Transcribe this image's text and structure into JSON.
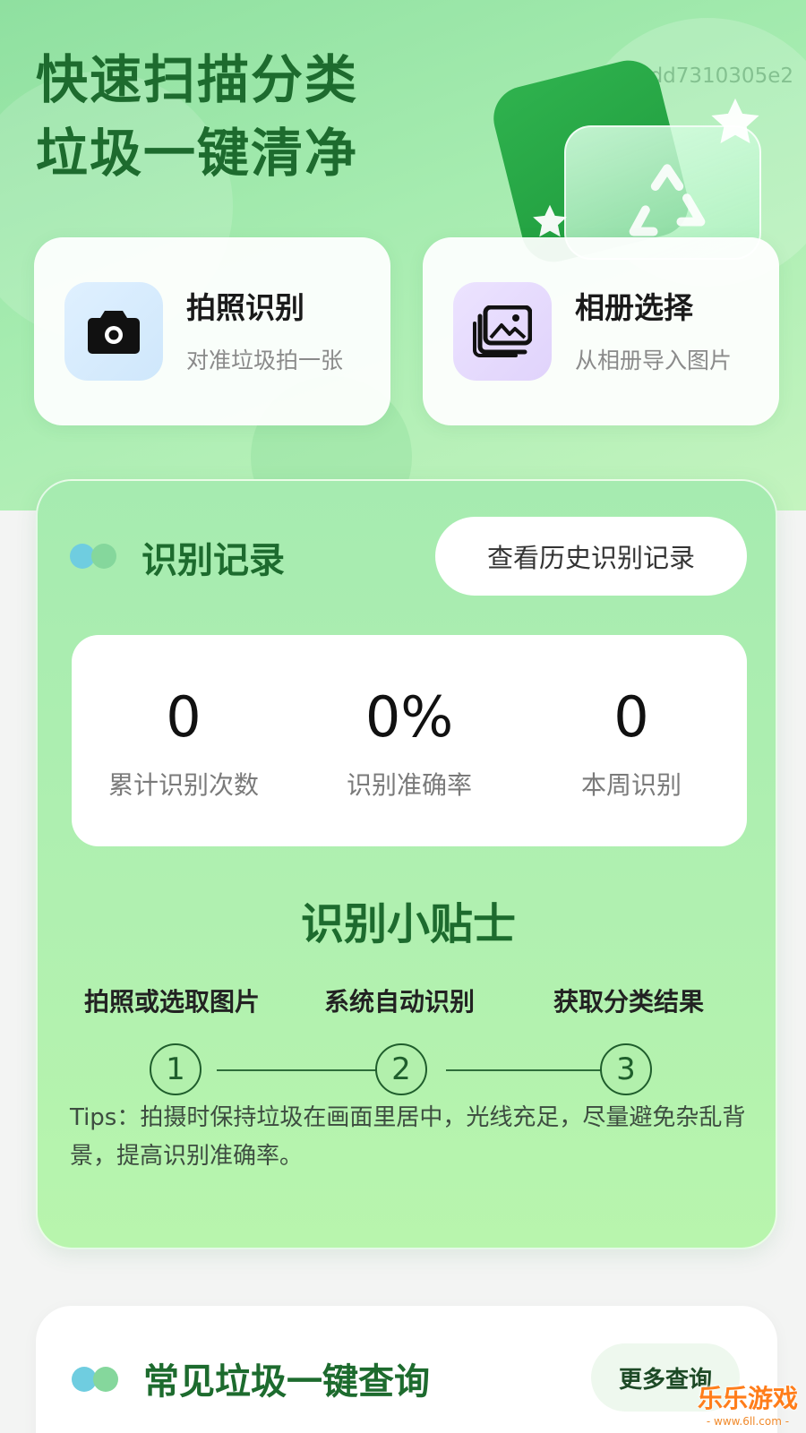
{
  "hero": {
    "title_line1": "快速扫描分类",
    "title_line2": "垃圾一键清净",
    "hash": "ef136dd7310305e2",
    "illustration_icon": "recycle-icon"
  },
  "actions": [
    {
      "title": "拍照识别",
      "subtitle": "对准垃圾拍一张",
      "icon": "camera-icon"
    },
    {
      "title": "相册选择",
      "subtitle": "从相册导入图片",
      "icon": "photo-album-icon"
    }
  ],
  "records": {
    "title": "识别记录",
    "history_button": "查看历史识别记录",
    "stats": [
      {
        "value": "0",
        "label": "累计识别次数"
      },
      {
        "value": "0%",
        "label": "识别准确率"
      },
      {
        "value": "0",
        "label": "本周识别"
      }
    ]
  },
  "tips": {
    "title": "识别小贴士",
    "steps": [
      {
        "label": "拍照或选取图片",
        "number": "1"
      },
      {
        "label": "系统自动识别",
        "number": "2"
      },
      {
        "label": "获取分类结果",
        "number": "3"
      }
    ],
    "text": "Tips：拍摄时保持垃圾在画面里居中，光线充足，尽量避免杂乱背景，提高识别准确率。"
  },
  "common_query": {
    "title": "常见垃圾一键查询",
    "more_button": "更多查询"
  },
  "watermark": {
    "title": "乐乐游戏",
    "url": "- www.6ll.com -"
  },
  "colors": {
    "brand_green": "#1d6b2e",
    "hero_gradient_start": "#8fe0a0",
    "panel_green": "#b0f0b0"
  }
}
